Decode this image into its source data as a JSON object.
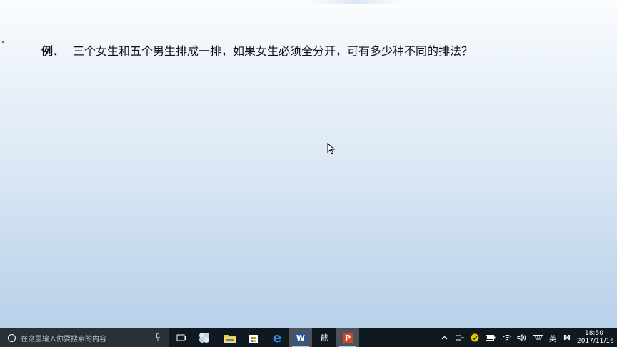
{
  "slide": {
    "example_label": "例．",
    "problem_text": "三个女生和五个男生排成一排，如果女生必须全分开，可有多少种不同的排法？"
  },
  "taskbar": {
    "search_placeholder": "在这里输入你要搜索的内容",
    "pinned_apps": [
      {
        "name": "task-view",
        "label": ""
      },
      {
        "name": "media-app",
        "label": ""
      },
      {
        "name": "file-explorer",
        "label": ""
      },
      {
        "name": "store",
        "label": ""
      },
      {
        "name": "edge",
        "label": "e"
      },
      {
        "name": "word",
        "label": "W"
      },
      {
        "name": "capture-app",
        "label": "截"
      },
      {
        "name": "powerpoint",
        "label": "P"
      }
    ],
    "tray": {
      "language": "英",
      "ime": "M",
      "time": "18:50",
      "date": "2017/11/16"
    }
  }
}
